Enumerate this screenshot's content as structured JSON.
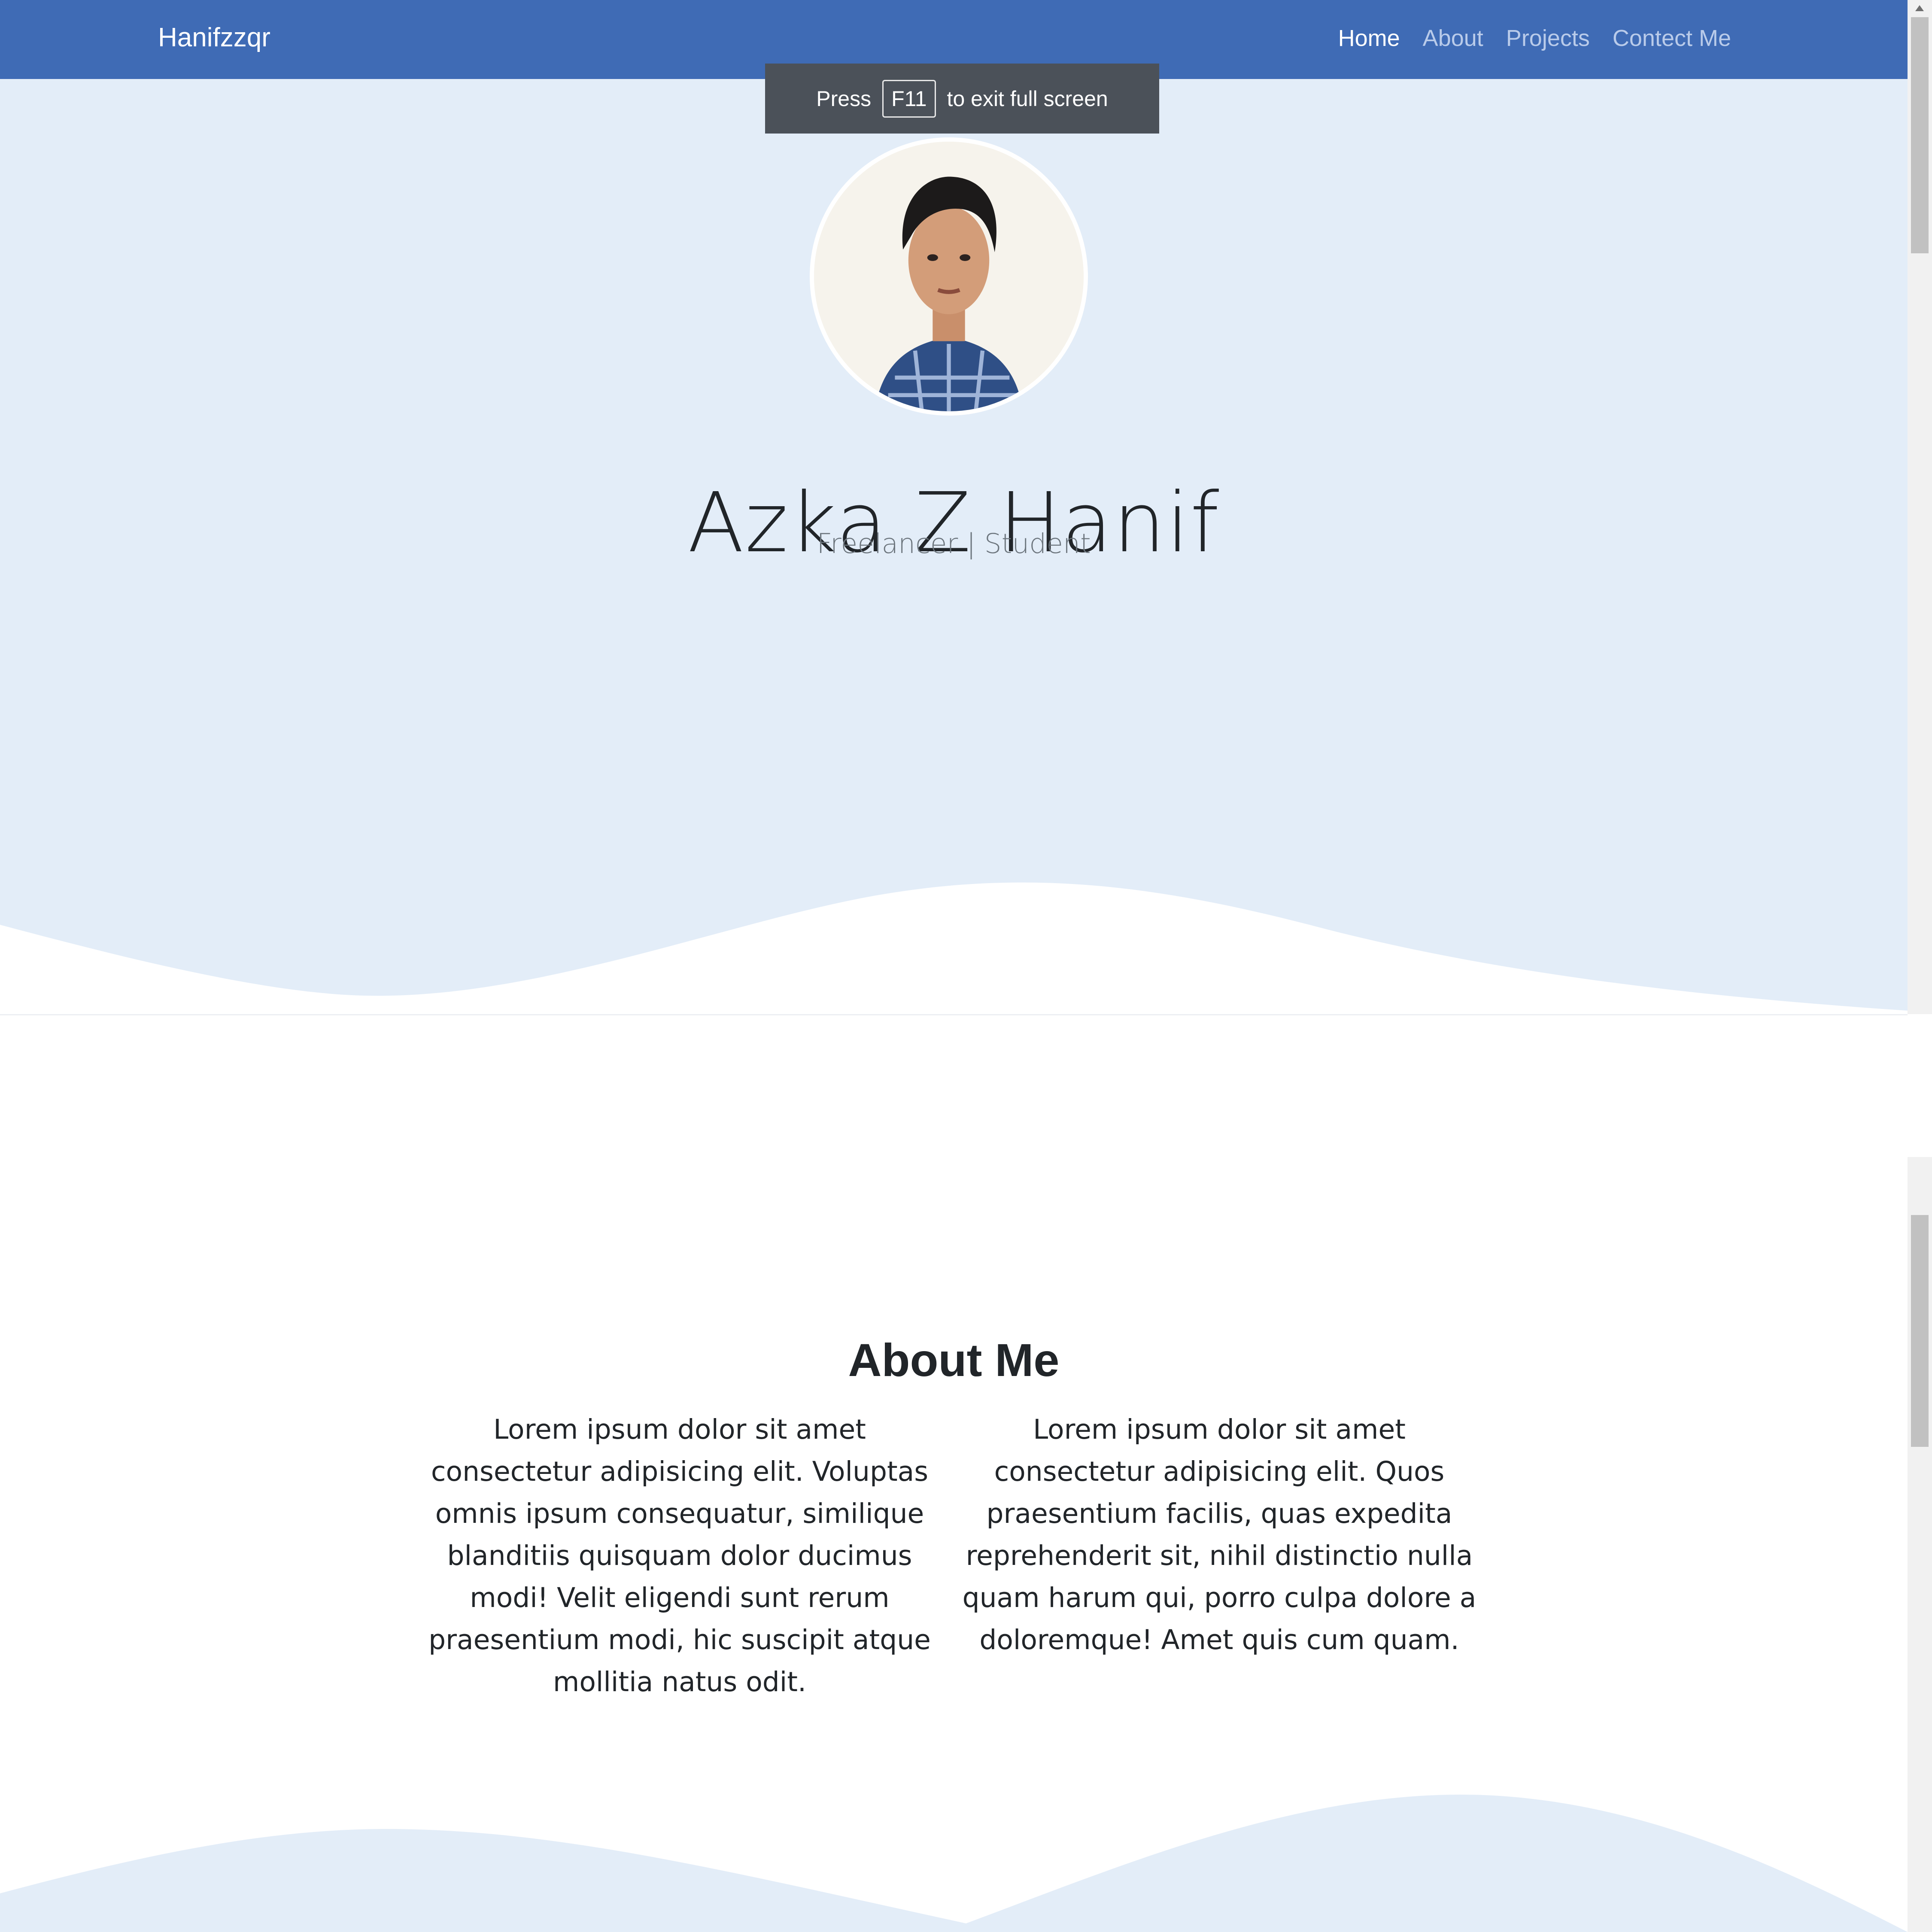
{
  "navbar": {
    "brand": "Hanifzzqr",
    "links": [
      "Home",
      "About",
      "Projects",
      "Contect Me"
    ],
    "active_index": 0,
    "bg_color": "#3f6bb5"
  },
  "fullscreen_toast": {
    "prefix": "Press",
    "key": "F11",
    "suffix": "to exit full screen"
  },
  "hero": {
    "avatar_icon": "profile-photo",
    "name": "Azka Z Hanif",
    "subtitle": "Freelancer | Student",
    "bg_color": "#e3edf8"
  },
  "about": {
    "title": "About Me",
    "paragraph_left": "Lorem ipsum dolor sit amet consectetur adipisicing elit. Voluptas omnis ipsum consequatur, similique blanditiis quisquam dolor ducimus modi! Velit eligendi sunt rerum praesentium modi, hic suscipit atque mollitia natus odit.",
    "paragraph_right": "Lorem ipsum dolor sit amet consectetur adipisicing elit. Quos praesentium facilis, quas expedita reprehenderit sit, nihil distinctio nulla quam harum qui, porro culpa dolore a doloremque! Amet quis cum quam."
  }
}
